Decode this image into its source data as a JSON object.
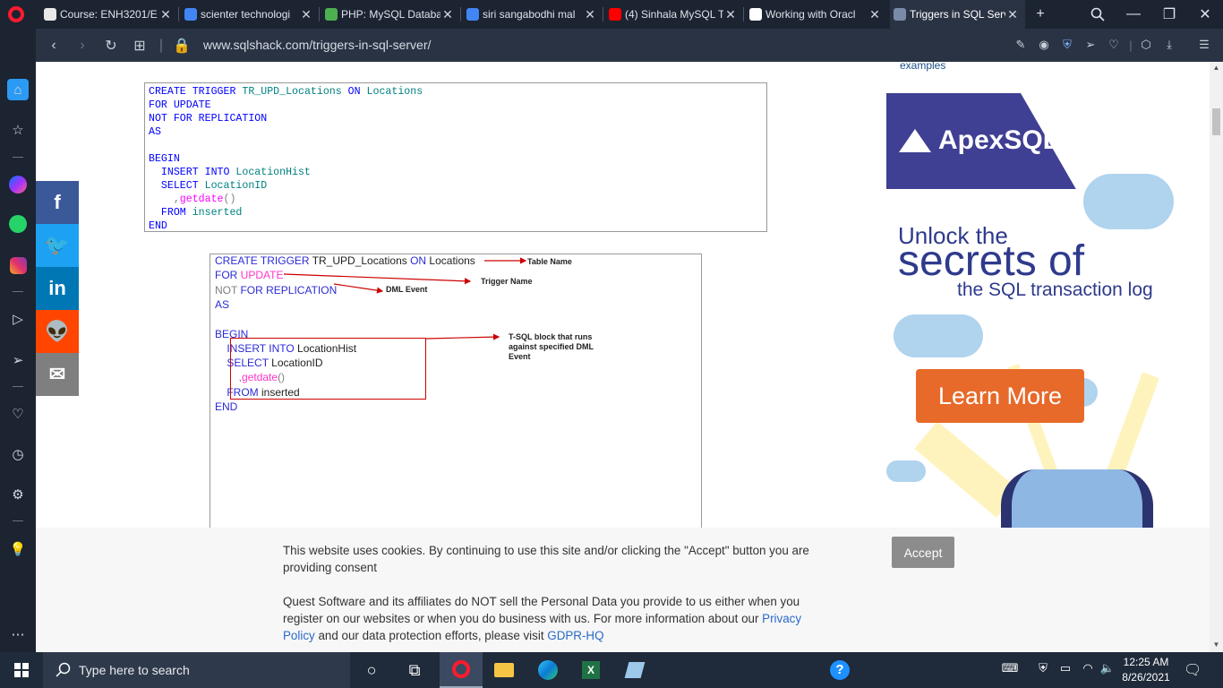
{
  "browser": {
    "tabs": [
      {
        "title": "Course: ENH3201/E",
        "favicon": "course-icon",
        "color": "#e8e8e8"
      },
      {
        "title": "scienter technologi",
        "favicon": "google-icon",
        "color": "#4285f4"
      },
      {
        "title": "PHP: MySQL Databa",
        "favicon": "w3-icon",
        "color": "#4caf50"
      },
      {
        "title": "siri sangabodhi mal",
        "favicon": "google-icon",
        "color": "#4285f4"
      },
      {
        "title": "(4) Sinhala MySQL T",
        "favicon": "youtube-icon",
        "color": "#ff0000"
      },
      {
        "title": "Working with Oracl",
        "favicon": "ycombinator-icon",
        "color": "#ffffff"
      },
      {
        "title": "Triggers in SQL Serv",
        "favicon": "sqlshack-icon",
        "color": "#7a8aa8",
        "active": true
      }
    ],
    "url": "www.sqlshack.com/triggers-in-sql-server/"
  },
  "social": [
    {
      "name": "facebook",
      "glyph": "f",
      "color": "#3b5998"
    },
    {
      "name": "twitter",
      "glyph": "🐦",
      "color": "#1da1f2"
    },
    {
      "name": "linkedin",
      "glyph": "in",
      "color": "#0077b5"
    },
    {
      "name": "reddit",
      "glyph": "👽",
      "color": "#ff4500"
    },
    {
      "name": "email",
      "glyph": "✉",
      "color": "#7f7f7f"
    }
  ],
  "code": {
    "lines": [
      [
        [
          "kw",
          "CREATE TRIGGER "
        ],
        [
          "id",
          "TR_UPD_Locations "
        ],
        [
          "kw",
          "ON "
        ],
        [
          "id",
          "Locations"
        ]
      ],
      [
        [
          "kw",
          "FOR UPDATE"
        ]
      ],
      [
        [
          "kw",
          "NOT FOR REPLICATION"
        ]
      ],
      [
        [
          "kw",
          "AS"
        ]
      ],
      [
        [
          "kw",
          ""
        ]
      ],
      [
        [
          "kw",
          "BEGIN"
        ]
      ],
      [
        [
          "kw",
          "  INSERT INTO "
        ],
        [
          "id",
          "LocationHist"
        ]
      ],
      [
        [
          "kw",
          "  SELECT "
        ],
        [
          "id",
          "LocationID"
        ]
      ],
      [
        [
          "gr",
          "    ,"
        ],
        [
          "fn",
          "getdate"
        ],
        [
          "gr",
          "()"
        ]
      ],
      [
        [
          "kw",
          "  FROM "
        ],
        [
          "id",
          "inserted"
        ]
      ],
      [
        [
          "kw",
          "END"
        ]
      ]
    ]
  },
  "diagram": {
    "lines": [
      [
        [
          "kw",
          "CREATE TRIGGER "
        ],
        [
          "plain",
          "TR_UPD_Locations "
        ],
        [
          "kw",
          "ON "
        ],
        [
          "plain",
          "Locations"
        ]
      ],
      [
        [
          "kw",
          "FOR "
        ],
        [
          "fn",
          "UPDATE"
        ]
      ],
      [
        [
          "gr",
          "NOT "
        ],
        [
          "kw",
          "FOR REPLICATION"
        ]
      ],
      [
        [
          "kw",
          "AS"
        ]
      ],
      [
        [
          "kw",
          ""
        ]
      ],
      [
        [
          "kw",
          "BEGIN"
        ]
      ],
      [
        [
          "kw",
          "    INSERT INTO "
        ],
        [
          "plain",
          "LocationHist"
        ]
      ],
      [
        [
          "kw",
          "    SELECT "
        ],
        [
          "plain",
          "LocationID"
        ]
      ],
      [
        [
          "gr",
          "        ,"
        ],
        [
          "fn",
          "getdate"
        ],
        [
          "gr",
          "()"
        ]
      ],
      [
        [
          "kw",
          "    FROM "
        ],
        [
          "plain",
          "inserted"
        ]
      ],
      [
        [
          "kw",
          "END"
        ]
      ]
    ],
    "annotations": {
      "table_name": "Table Name",
      "trigger_name": "Trigger Name",
      "dml_event": "DML Event",
      "tsql_block": "T-SQL block that runs against specified DML Event"
    }
  },
  "sidebar_link_fragment": "examples",
  "ad": {
    "brand": "ApexSQL",
    "line1": "Unlock the",
    "line2": "secrets of",
    "line3": "the SQL transaction log",
    "cta": "Learn More"
  },
  "cookie": {
    "text1": "This website uses cookies. By continuing to use this site and/or clicking the \"Accept\" button you are providing consent",
    "text2_a": "Quest Software and its affiliates do NOT sell the Personal Data you provide to us either when you register on our websites or when you do business with us. For more information about our ",
    "privacy_link": "Privacy Policy",
    "text2_b": " and our data protection efforts, please visit ",
    "gdpr_link": "GDPR-HQ",
    "accept": "Accept"
  },
  "taskbar": {
    "search_placeholder": "Type here to search",
    "time": "12:25 AM",
    "date": "8/26/2021"
  }
}
